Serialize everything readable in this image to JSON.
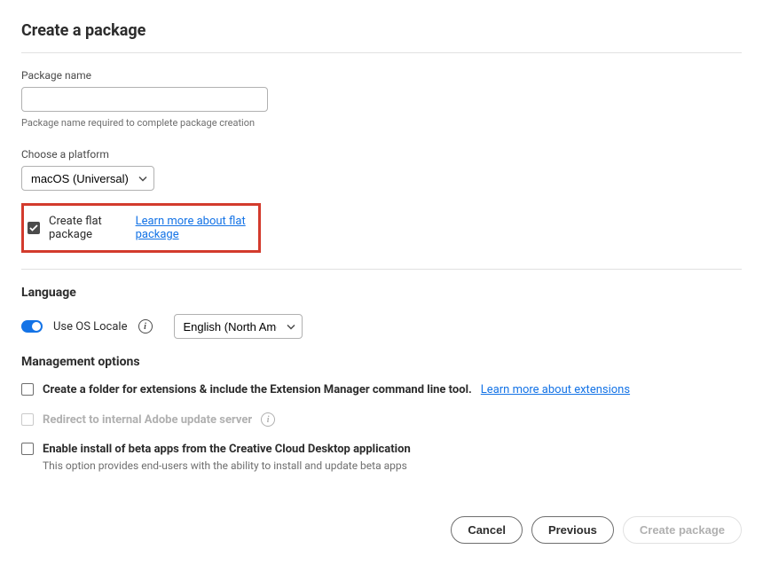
{
  "title": "Create a package",
  "packageName": {
    "label": "Package name",
    "value": "",
    "helper": "Package name required to complete package creation"
  },
  "platform": {
    "label": "Choose a platform",
    "value": "macOS (Universal)"
  },
  "flatPackage": {
    "checked": true,
    "label": "Create flat package",
    "link": "Learn more about flat package"
  },
  "language": {
    "heading": "Language",
    "toggleLabel": "Use OS Locale",
    "value": "English (North America)"
  },
  "management": {
    "heading": "Management options",
    "options": {
      "extensions": {
        "label": "Create a folder for extensions & include the Extension Manager command line tool.",
        "link": "Learn more about extensions"
      },
      "redirect": {
        "label": "Redirect to internal Adobe update server"
      },
      "beta": {
        "label": "Enable install of beta apps from the Creative Cloud Desktop application",
        "helper": "This option provides end-users with the ability to install and update beta apps"
      }
    }
  },
  "footer": {
    "cancel": "Cancel",
    "previous": "Previous",
    "create": "Create package"
  }
}
